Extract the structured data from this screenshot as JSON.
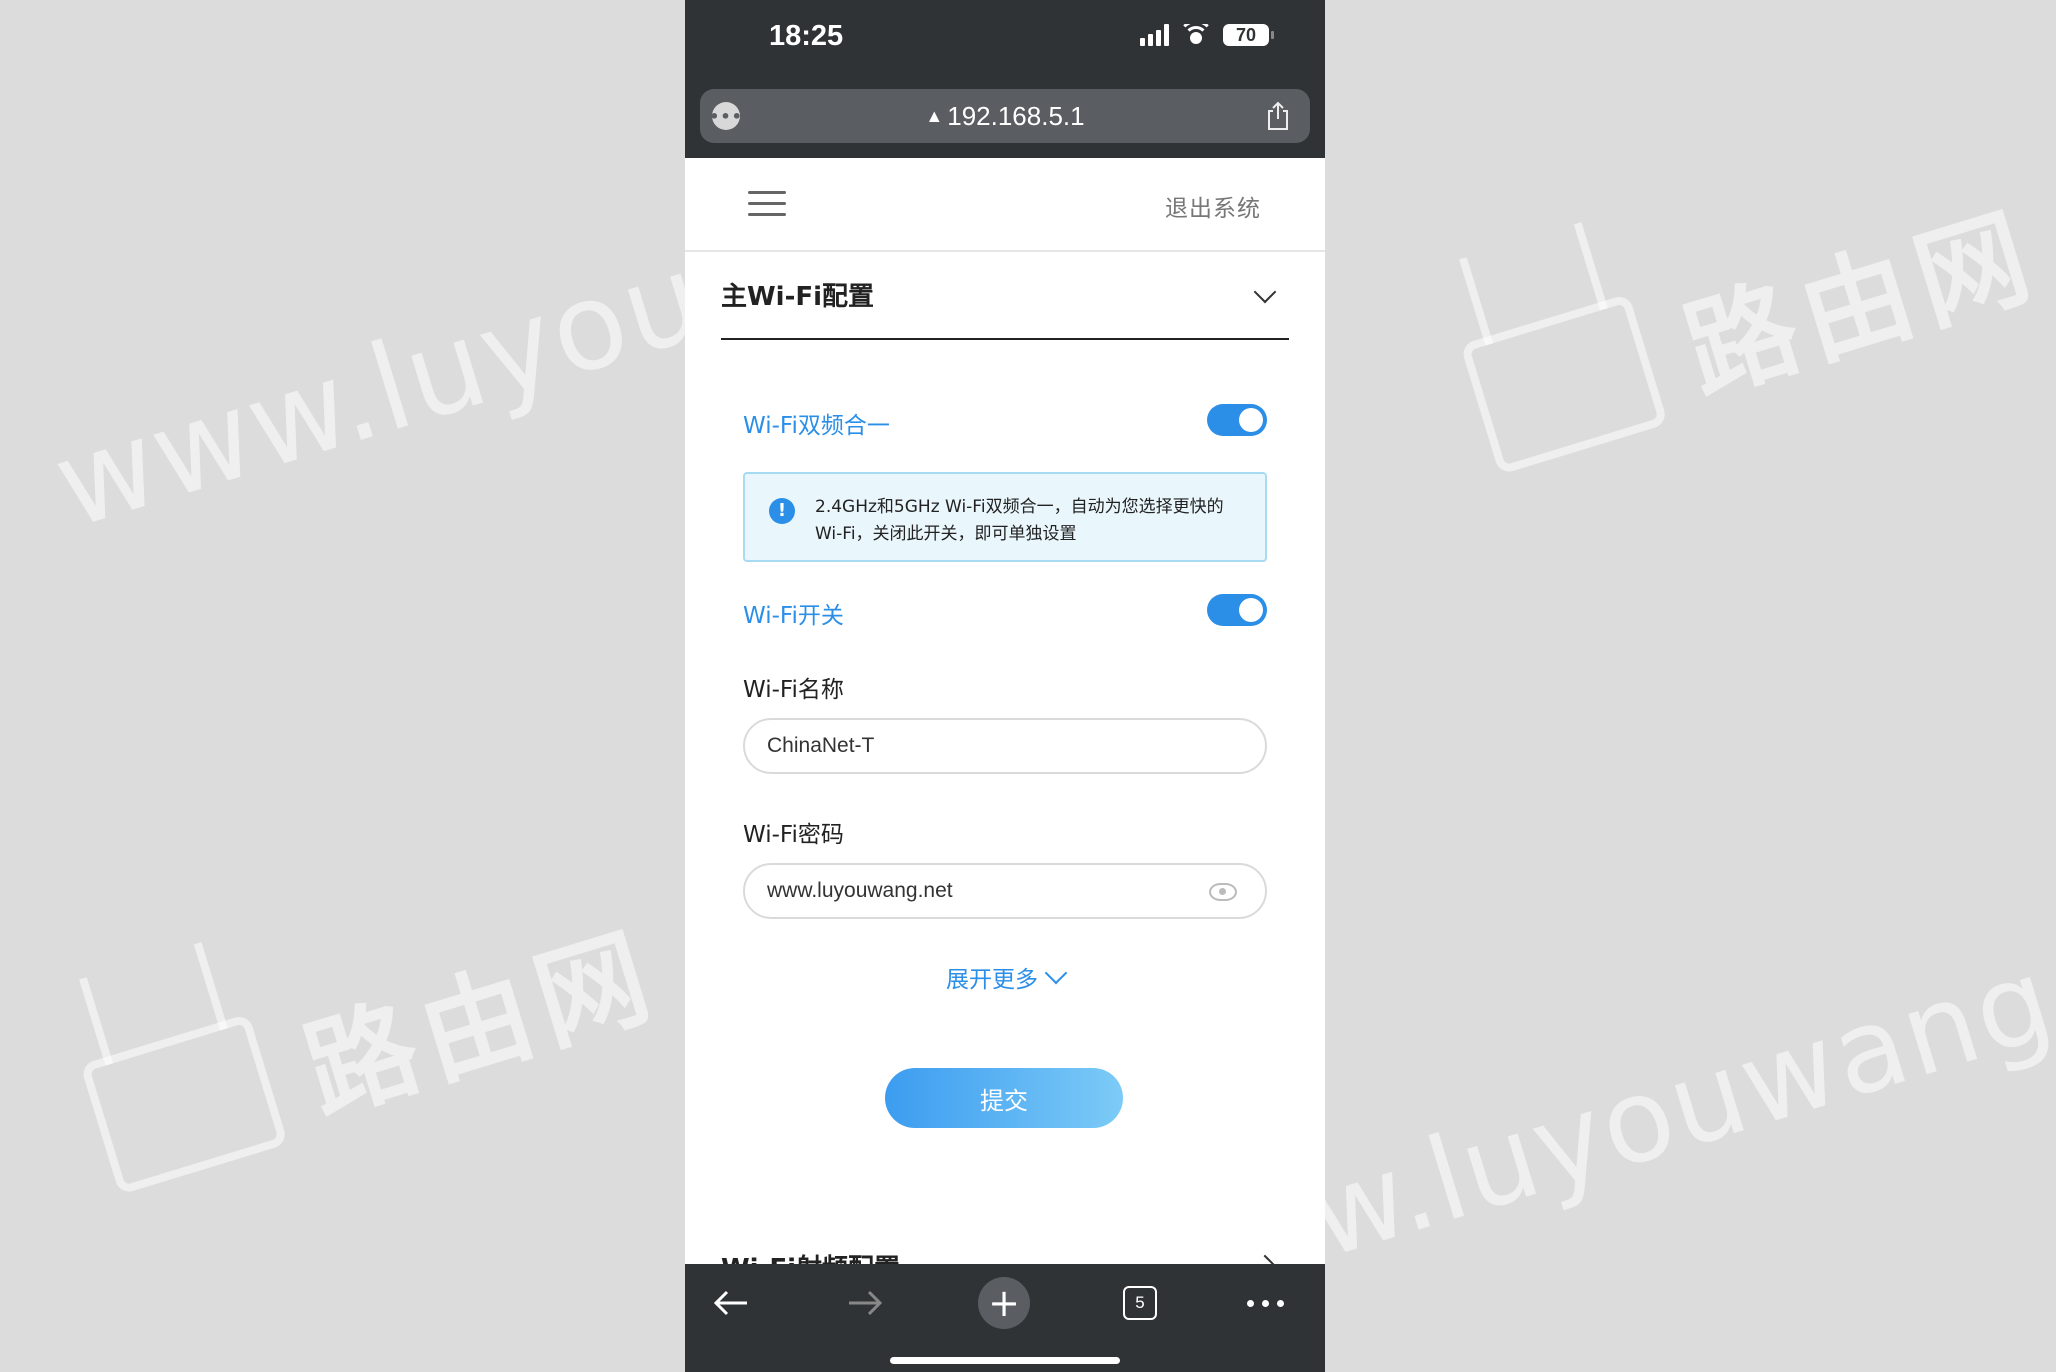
{
  "status_bar": {
    "time": "18:25",
    "battery": "70"
  },
  "browser": {
    "url": "192.168.5.1",
    "tab_count": "5"
  },
  "header": {
    "logout_label": "退出系统"
  },
  "section": {
    "title": "主Wi-Fi配置",
    "next_section_title": "Wi-Fi射频配置"
  },
  "dual_band": {
    "label": "Wi-Fi双频合一",
    "enabled": true
  },
  "info": {
    "text": "2.4GHz和5GHz Wi-Fi双频合一，自动为您选择更快的Wi-Fi，关闭此开关，即可单独设置"
  },
  "wifi_switch": {
    "label": "Wi-Fi开关",
    "enabled": true
  },
  "wifi_name": {
    "label": "Wi-Fi名称",
    "value": "ChinaNet-T"
  },
  "wifi_password": {
    "label": "Wi-Fi密码",
    "value": "www.luyouwang.net"
  },
  "expand_more": {
    "label": "展开更多"
  },
  "submit": {
    "label": "提交"
  },
  "watermarks": {
    "text": "www.luyouwang.net",
    "brand": "路由网"
  },
  "colors": {
    "accent": "#2b8fe8",
    "bar": "#2f3336"
  }
}
